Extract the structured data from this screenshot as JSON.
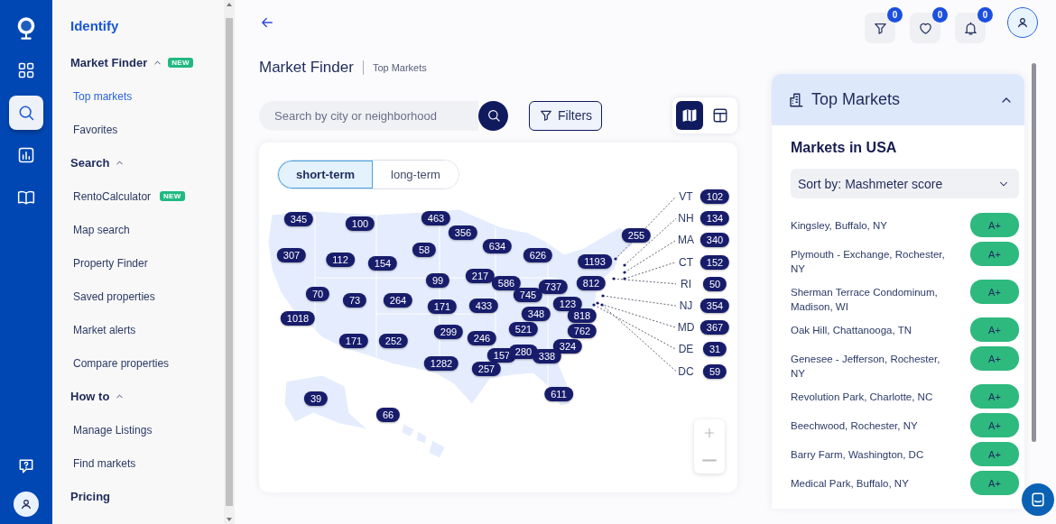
{
  "rail": {
    "items": [
      {
        "kind": "logo",
        "selected": false
      },
      {
        "kind": "dashboard",
        "selected": false
      },
      {
        "kind": "search",
        "selected": true
      },
      {
        "kind": "chart",
        "selected": false
      },
      {
        "kind": "guide",
        "selected": false
      },
      {
        "kind": "help",
        "selected": false
      },
      {
        "kind": "profile",
        "selected": false
      }
    ]
  },
  "sidebar": {
    "title": "Identify",
    "groups": [
      {
        "label": "Market Finder",
        "expanded": true,
        "badge": "NEW",
        "items": [
          {
            "label": "Top markets",
            "selected": true
          },
          {
            "label": "Favorites",
            "selected": false
          }
        ]
      },
      {
        "label": "Search",
        "expanded": true,
        "items": [
          {
            "label": "RentoCalculator",
            "selected": false,
            "badge": "NEW"
          },
          {
            "label": "Map search",
            "selected": false
          },
          {
            "label": "Property Finder",
            "selected": false
          },
          {
            "label": "Saved properties",
            "selected": false
          },
          {
            "label": "Market alerts",
            "selected": false
          },
          {
            "label": "Compare properties",
            "selected": false
          }
        ]
      },
      {
        "label": "How to",
        "expanded": true,
        "items": [
          {
            "label": "Manage Listings",
            "selected": false
          },
          {
            "label": "Find markets",
            "selected": false
          }
        ]
      },
      {
        "label": "Pricing"
      }
    ]
  },
  "topbar": {
    "actions": [
      {
        "kind": "filter",
        "count": "0"
      },
      {
        "kind": "favorite",
        "count": "0"
      },
      {
        "kind": "notification",
        "count": "0"
      }
    ]
  },
  "page": {
    "title": "Market Finder",
    "breadcrumb": "Top Markets"
  },
  "search": {
    "placeholder": "Search by city or neighborhood"
  },
  "filters_button": "Filters",
  "view_toggle": [
    {
      "kind": "map",
      "selected": true
    },
    {
      "kind": "table",
      "selected": false
    }
  ],
  "map": {
    "tabs": [
      {
        "label": "short-term",
        "selected": true
      },
      {
        "label": "long-term",
        "selected": false
      }
    ],
    "regions": [
      {
        "value": "345"
      },
      {
        "value": "100"
      },
      {
        "value": "463"
      },
      {
        "value": "356"
      },
      {
        "value": "255"
      },
      {
        "value": "58"
      },
      {
        "value": "634"
      },
      {
        "value": "307"
      },
      {
        "value": "112"
      },
      {
        "value": "154"
      },
      {
        "value": "626"
      },
      {
        "value": "1193"
      },
      {
        "value": "99"
      },
      {
        "value": "217"
      },
      {
        "value": "586"
      },
      {
        "value": "737"
      },
      {
        "value": "812"
      },
      {
        "value": "70"
      },
      {
        "value": "73"
      },
      {
        "value": "264"
      },
      {
        "value": "171"
      },
      {
        "value": "433"
      },
      {
        "value": "745"
      },
      {
        "value": "123"
      },
      {
        "value": "1018"
      },
      {
        "value": "348"
      },
      {
        "value": "818"
      },
      {
        "value": "299"
      },
      {
        "value": "521"
      },
      {
        "value": "762"
      },
      {
        "value": "171"
      },
      {
        "value": "252"
      },
      {
        "value": "246"
      },
      {
        "value": "324"
      },
      {
        "value": "157"
      },
      {
        "value": "280"
      },
      {
        "value": "338"
      },
      {
        "value": "1282"
      },
      {
        "value": "257"
      },
      {
        "value": "39"
      },
      {
        "value": "611"
      },
      {
        "value": "66"
      }
    ],
    "legend": [
      {
        "label": "VT",
        "value": "102"
      },
      {
        "label": "NH",
        "value": "134"
      },
      {
        "label": "MA",
        "value": "340"
      },
      {
        "label": "CT",
        "value": "152"
      },
      {
        "label": "RI",
        "value": "50"
      },
      {
        "label": "NJ",
        "value": "354"
      },
      {
        "label": "MD",
        "value": "367"
      },
      {
        "label": "DE",
        "value": "31"
      },
      {
        "label": "DC",
        "value": "59"
      }
    ]
  },
  "panel": {
    "title": "Top Markets",
    "expanded": true,
    "subtitle": "Markets in USA",
    "sort": "Sort by: Mashmeter score",
    "markets": [
      {
        "name": "Kingsley, Buffalo, NY",
        "grade": "A+"
      },
      {
        "name": "Plymouth - Exchange, Rochester, NY",
        "grade": "A+"
      },
      {
        "name": "Sherman Terrace Condominum, Madison, WI",
        "grade": "A+"
      },
      {
        "name": "Oak Hill, Chattanooga, TN",
        "grade": "A+"
      },
      {
        "name": "Genesee - Jefferson, Rochester, NY",
        "grade": "A+"
      },
      {
        "name": "Revolution Park, Charlotte, NC",
        "grade": "A+"
      },
      {
        "name": "Beechwood, Rochester, NY",
        "grade": "A+"
      },
      {
        "name": "Barry Farm, Washington, DC",
        "grade": "A+"
      },
      {
        "name": "Medical Park, Buffalo, NY",
        "grade": "A+"
      }
    ]
  }
}
